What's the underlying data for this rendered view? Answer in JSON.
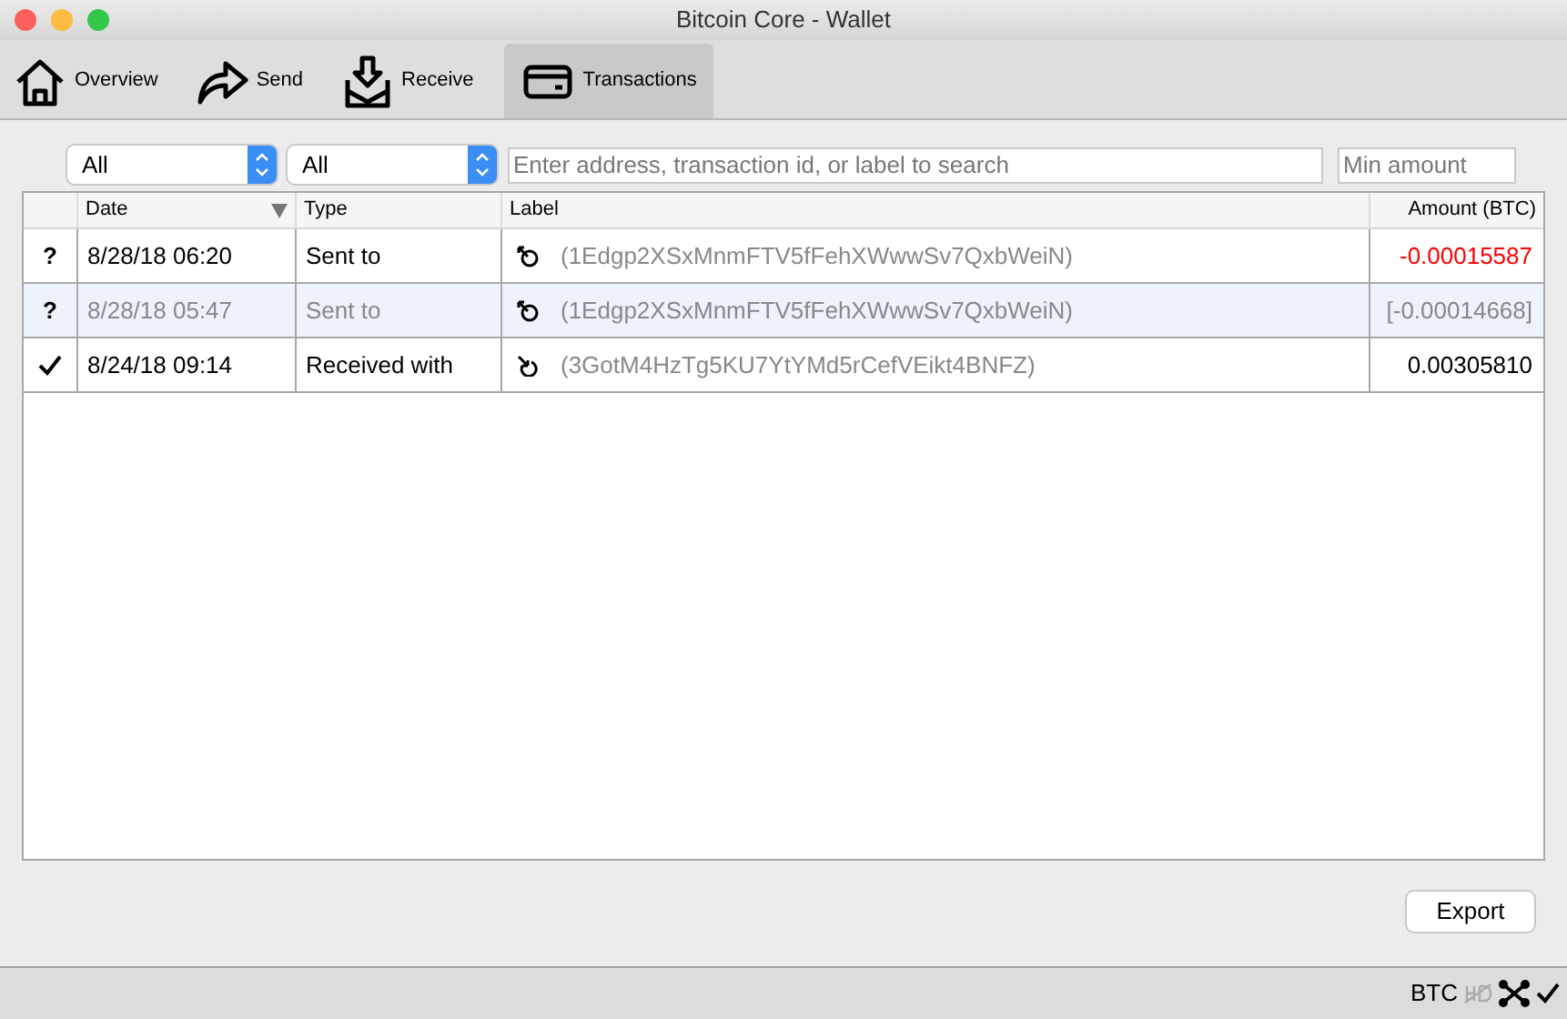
{
  "window": {
    "title": "Bitcoin Core - Wallet"
  },
  "tabs": [
    {
      "label": "Overview",
      "kind": "home",
      "selected": false
    },
    {
      "label": "Send",
      "kind": "send",
      "selected": false
    },
    {
      "label": "Receive",
      "kind": "receive",
      "selected": false
    },
    {
      "label": "Transactions",
      "kind": "card",
      "selected": true
    }
  ],
  "filters": {
    "date_range": "All",
    "type": "All",
    "search": {
      "placeholder": "Enter address, transaction id, or label to search"
    },
    "min_amount": {
      "placeholder": "Min amount"
    }
  },
  "table": {
    "columns": [
      "Date",
      "Type",
      "Label",
      "Amount (BTC)"
    ],
    "rows": [
      {
        "confirmed": false,
        "status_symbol": "?",
        "date": "8/28/18 06:20",
        "type": "Sent to",
        "outgoing": true,
        "label": "(1Edgp2XSxMnmFTV5fFehXWwwSv7QxbWeiN)",
        "amount": {
          "text": "-0.00015587",
          "color": "#ff0000"
        },
        "dimmed": false
      },
      {
        "confirmed": false,
        "status_symbol": "?",
        "date": "8/28/18 05:47",
        "type": "Sent to",
        "outgoing": true,
        "label": "(1Edgp2XSxMnmFTV5fFehXWwwSv7QxbWeiN)",
        "amount": {
          "text": "[-0.00014668]",
          "color": "#888888"
        },
        "dimmed": true
      },
      {
        "confirmed": true,
        "date": "8/24/18 09:14",
        "type": "Received with",
        "outgoing": false,
        "label": "(3GotM4HzTg5KU7YtYMd5rCefVEikt4BNFZ)",
        "amount": {
          "text": "0.00305810",
          "color": "#000000"
        },
        "dimmed": false
      }
    ]
  },
  "export_button": "Export",
  "status_bar": {
    "unit": "BTC"
  }
}
